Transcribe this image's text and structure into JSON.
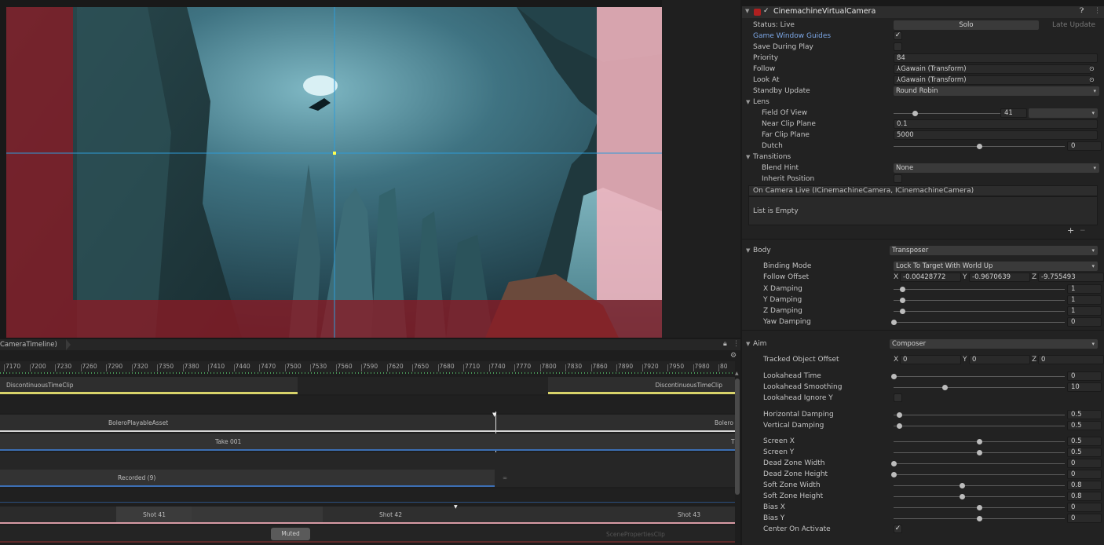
{
  "scene": {
    "colors": {
      "dead_zone": "#c8d8e8",
      "soft_left": "#8b1a24",
      "soft_right": "#f7b5bf",
      "guide_line": "#2e9bd8",
      "target": "#ffff50"
    }
  },
  "timeline": {
    "breadcrumb": "CameraTimeline)",
    "ruler": [
      "7170",
      "7200",
      "7230",
      "7260",
      "7290",
      "7320",
      "7350",
      "7380",
      "7410",
      "7440",
      "7470",
      "7500",
      "7530",
      "7560",
      "7590",
      "7620",
      "7650",
      "7680",
      "7710",
      "7740",
      "7770",
      "7800",
      "7830",
      "7860",
      "7890",
      "7920",
      "7950",
      "7980",
      "80"
    ],
    "clip_discont_left": "DiscontinuousTimeClip",
    "clip_discont_right": "DiscontinuousTimeClip",
    "clip_bolero": "BoleroPlayableAsset",
    "clip_bolero_right": "Bolero",
    "clip_take": "Take 001",
    "clip_take_right": "T",
    "clip_recorded": "Recorded (9)",
    "shot41": "Shot 41",
    "shot42": "Shot 42",
    "shot43": "Shot 43",
    "muted": "Muted",
    "scene_props": "ScenePropertiesClip"
  },
  "inspector": {
    "component_title": "CinemachineVirtualCamera",
    "status": "Status: Live",
    "solo": "Solo",
    "late_update": "Late Update",
    "game_window_guides": "Game Window Guides",
    "save_during_play": "Save During Play",
    "priority_label": "Priority",
    "priority_value": "84",
    "follow_label": "Follow",
    "follow_value": "Gawain (Transform)",
    "look_at_label": "Look At",
    "look_at_value": "Gawain (Transform)",
    "standby_label": "Standby Update",
    "standby_value": "Round Robin",
    "lens": "Lens",
    "fov_label": "Field Of View",
    "fov_value": "41",
    "near_label": "Near Clip Plane",
    "near_value": "0.1",
    "far_label": "Far Clip Plane",
    "far_value": "5000",
    "dutch_label": "Dutch",
    "dutch_value": "0",
    "transitions": "Transitions",
    "blend_hint_label": "Blend Hint",
    "blend_hint_value": "None",
    "inherit_label": "Inherit Position",
    "event_title": "On Camera Live (ICinemachineCamera, ICinemachineCamera)",
    "list_empty": "List is Empty",
    "plus": "+",
    "minus": "−",
    "body": "Body",
    "body_value": "Transposer",
    "binding_label": "Binding Mode",
    "binding_value": "Lock To Target With World Up",
    "follow_offset_label": "Follow Offset",
    "fo_x": "-0.00428772",
    "fo_y": "-0.9670639",
    "fo_z": "-9.755493",
    "xdamp_label": "X Damping",
    "xdamp_value": "1",
    "ydamp_label": "Y Damping",
    "ydamp_value": "1",
    "zdamp_label": "Z Damping",
    "zdamp_value": "1",
    "yawdamp_label": "Yaw Damping",
    "yawdamp_value": "0",
    "aim": "Aim",
    "aim_value": "Composer",
    "tracked_label": "Tracked Object Offset",
    "to_x": "0",
    "to_y": "0",
    "to_z": "0",
    "x_letter": "X",
    "y_letter": "Y",
    "z_letter": "Z",
    "lookahead_time_label": "Lookahead Time",
    "lookahead_time_value": "0",
    "lookahead_smooth_label": "Lookahead Smoothing",
    "lookahead_smooth_value": "10",
    "lookahead_ignore_label": "Lookahead Ignore Y",
    "hdamp_label": "Horizontal Damping",
    "hdamp_value": "0.5",
    "vdamp_label": "Vertical Damping",
    "vdamp_value": "0.5",
    "screenx_label": "Screen X",
    "screenx_value": "0.5",
    "screeny_label": "Screen Y",
    "screeny_value": "0.5",
    "dzw_label": "Dead Zone Width",
    "dzw_value": "0",
    "dzh_label": "Dead Zone Height",
    "dzh_value": "0",
    "szw_label": "Soft Zone Width",
    "szw_value": "0.8",
    "szh_label": "Soft Zone Height",
    "szh_value": "0.8",
    "biasx_label": "Bias X",
    "biasx_value": "0",
    "biasy_label": "Bias Y",
    "biasy_value": "0",
    "center_label": "Center On Activate",
    "check": "✓",
    "colors": {
      "accent_link": "#7ca7e6",
      "header_bg": "#2d2d2d",
      "field_bg": "#2a2a2a"
    },
    "sliders": {
      "fov": 0.2,
      "dutch": 0.5,
      "xdamp": 0.05,
      "ydamp": 0.05,
      "zdamp": 0.05,
      "yawdamp": 0.0,
      "lookahead_time": 0.0,
      "lookahead_smooth": 0.3,
      "hdamp": 0.03,
      "vdamp": 0.03,
      "screenx": 0.5,
      "screeny": 0.5,
      "dzw": 0.0,
      "dzh": 0.0,
      "szw": 0.4,
      "szh": 0.4,
      "biasx": 0.5,
      "biasy": 0.5
    }
  }
}
